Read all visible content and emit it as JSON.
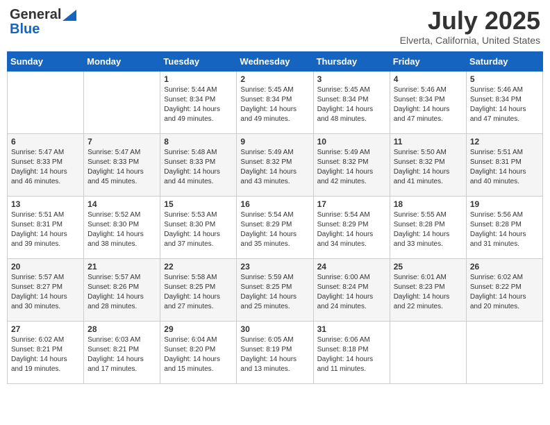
{
  "header": {
    "logo_general": "General",
    "logo_blue": "Blue",
    "month_title": "July 2025",
    "location": "Elverta, California, United States"
  },
  "weekdays": [
    "Sunday",
    "Monday",
    "Tuesday",
    "Wednesday",
    "Thursday",
    "Friday",
    "Saturday"
  ],
  "weeks": [
    [
      {
        "day": "",
        "sunrise": "",
        "sunset": "",
        "daylight": ""
      },
      {
        "day": "",
        "sunrise": "",
        "sunset": "",
        "daylight": ""
      },
      {
        "day": "1",
        "sunrise": "Sunrise: 5:44 AM",
        "sunset": "Sunset: 8:34 PM",
        "daylight": "Daylight: 14 hours and 49 minutes."
      },
      {
        "day": "2",
        "sunrise": "Sunrise: 5:45 AM",
        "sunset": "Sunset: 8:34 PM",
        "daylight": "Daylight: 14 hours and 49 minutes."
      },
      {
        "day": "3",
        "sunrise": "Sunrise: 5:45 AM",
        "sunset": "Sunset: 8:34 PM",
        "daylight": "Daylight: 14 hours and 48 minutes."
      },
      {
        "day": "4",
        "sunrise": "Sunrise: 5:46 AM",
        "sunset": "Sunset: 8:34 PM",
        "daylight": "Daylight: 14 hours and 47 minutes."
      },
      {
        "day": "5",
        "sunrise": "Sunrise: 5:46 AM",
        "sunset": "Sunset: 8:34 PM",
        "daylight": "Daylight: 14 hours and 47 minutes."
      }
    ],
    [
      {
        "day": "6",
        "sunrise": "Sunrise: 5:47 AM",
        "sunset": "Sunset: 8:33 PM",
        "daylight": "Daylight: 14 hours and 46 minutes."
      },
      {
        "day": "7",
        "sunrise": "Sunrise: 5:47 AM",
        "sunset": "Sunset: 8:33 PM",
        "daylight": "Daylight: 14 hours and 45 minutes."
      },
      {
        "day": "8",
        "sunrise": "Sunrise: 5:48 AM",
        "sunset": "Sunset: 8:33 PM",
        "daylight": "Daylight: 14 hours and 44 minutes."
      },
      {
        "day": "9",
        "sunrise": "Sunrise: 5:49 AM",
        "sunset": "Sunset: 8:32 PM",
        "daylight": "Daylight: 14 hours and 43 minutes."
      },
      {
        "day": "10",
        "sunrise": "Sunrise: 5:49 AM",
        "sunset": "Sunset: 8:32 PM",
        "daylight": "Daylight: 14 hours and 42 minutes."
      },
      {
        "day": "11",
        "sunrise": "Sunrise: 5:50 AM",
        "sunset": "Sunset: 8:32 PM",
        "daylight": "Daylight: 14 hours and 41 minutes."
      },
      {
        "day": "12",
        "sunrise": "Sunrise: 5:51 AM",
        "sunset": "Sunset: 8:31 PM",
        "daylight": "Daylight: 14 hours and 40 minutes."
      }
    ],
    [
      {
        "day": "13",
        "sunrise": "Sunrise: 5:51 AM",
        "sunset": "Sunset: 8:31 PM",
        "daylight": "Daylight: 14 hours and 39 minutes."
      },
      {
        "day": "14",
        "sunrise": "Sunrise: 5:52 AM",
        "sunset": "Sunset: 8:30 PM",
        "daylight": "Daylight: 14 hours and 38 minutes."
      },
      {
        "day": "15",
        "sunrise": "Sunrise: 5:53 AM",
        "sunset": "Sunset: 8:30 PM",
        "daylight": "Daylight: 14 hours and 37 minutes."
      },
      {
        "day": "16",
        "sunrise": "Sunrise: 5:54 AM",
        "sunset": "Sunset: 8:29 PM",
        "daylight": "Daylight: 14 hours and 35 minutes."
      },
      {
        "day": "17",
        "sunrise": "Sunrise: 5:54 AM",
        "sunset": "Sunset: 8:29 PM",
        "daylight": "Daylight: 14 hours and 34 minutes."
      },
      {
        "day": "18",
        "sunrise": "Sunrise: 5:55 AM",
        "sunset": "Sunset: 8:28 PM",
        "daylight": "Daylight: 14 hours and 33 minutes."
      },
      {
        "day": "19",
        "sunrise": "Sunrise: 5:56 AM",
        "sunset": "Sunset: 8:28 PM",
        "daylight": "Daylight: 14 hours and 31 minutes."
      }
    ],
    [
      {
        "day": "20",
        "sunrise": "Sunrise: 5:57 AM",
        "sunset": "Sunset: 8:27 PM",
        "daylight": "Daylight: 14 hours and 30 minutes."
      },
      {
        "day": "21",
        "sunrise": "Sunrise: 5:57 AM",
        "sunset": "Sunset: 8:26 PM",
        "daylight": "Daylight: 14 hours and 28 minutes."
      },
      {
        "day": "22",
        "sunrise": "Sunrise: 5:58 AM",
        "sunset": "Sunset: 8:25 PM",
        "daylight": "Daylight: 14 hours and 27 minutes."
      },
      {
        "day": "23",
        "sunrise": "Sunrise: 5:59 AM",
        "sunset": "Sunset: 8:25 PM",
        "daylight": "Daylight: 14 hours and 25 minutes."
      },
      {
        "day": "24",
        "sunrise": "Sunrise: 6:00 AM",
        "sunset": "Sunset: 8:24 PM",
        "daylight": "Daylight: 14 hours and 24 minutes."
      },
      {
        "day": "25",
        "sunrise": "Sunrise: 6:01 AM",
        "sunset": "Sunset: 8:23 PM",
        "daylight": "Daylight: 14 hours and 22 minutes."
      },
      {
        "day": "26",
        "sunrise": "Sunrise: 6:02 AM",
        "sunset": "Sunset: 8:22 PM",
        "daylight": "Daylight: 14 hours and 20 minutes."
      }
    ],
    [
      {
        "day": "27",
        "sunrise": "Sunrise: 6:02 AM",
        "sunset": "Sunset: 8:21 PM",
        "daylight": "Daylight: 14 hours and 19 minutes."
      },
      {
        "day": "28",
        "sunrise": "Sunrise: 6:03 AM",
        "sunset": "Sunset: 8:21 PM",
        "daylight": "Daylight: 14 hours and 17 minutes."
      },
      {
        "day": "29",
        "sunrise": "Sunrise: 6:04 AM",
        "sunset": "Sunset: 8:20 PM",
        "daylight": "Daylight: 14 hours and 15 minutes."
      },
      {
        "day": "30",
        "sunrise": "Sunrise: 6:05 AM",
        "sunset": "Sunset: 8:19 PM",
        "daylight": "Daylight: 14 hours and 13 minutes."
      },
      {
        "day": "31",
        "sunrise": "Sunrise: 6:06 AM",
        "sunset": "Sunset: 8:18 PM",
        "daylight": "Daylight: 14 hours and 11 minutes."
      },
      {
        "day": "",
        "sunrise": "",
        "sunset": "",
        "daylight": ""
      },
      {
        "day": "",
        "sunrise": "",
        "sunset": "",
        "daylight": ""
      }
    ]
  ]
}
